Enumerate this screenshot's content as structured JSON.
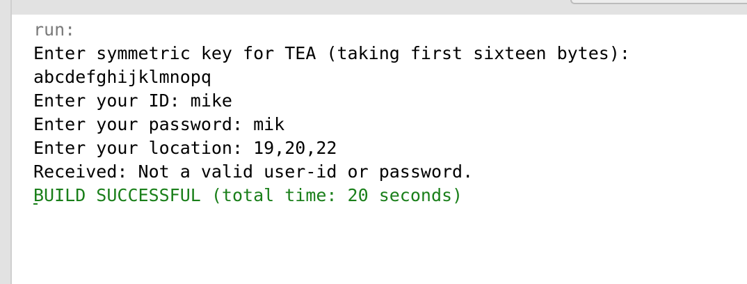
{
  "output": {
    "run": "run:",
    "lines": [
      "Enter symmetric key for TEA (taking first sixteen bytes):",
      "abcdefghijklmnopq",
      "Enter your ID: mike",
      "Enter your password: mik",
      "Enter your location: 19,20,22",
      "Received: Not a valid user-id or password."
    ],
    "build_status": "BUILD SUCCESSFUL (total time: 20 seconds)"
  },
  "colors": {
    "run_text": "#7a7a7a",
    "output_text": "#000000",
    "success_text": "#1a7f1a",
    "chrome": "#e2e2e2"
  }
}
